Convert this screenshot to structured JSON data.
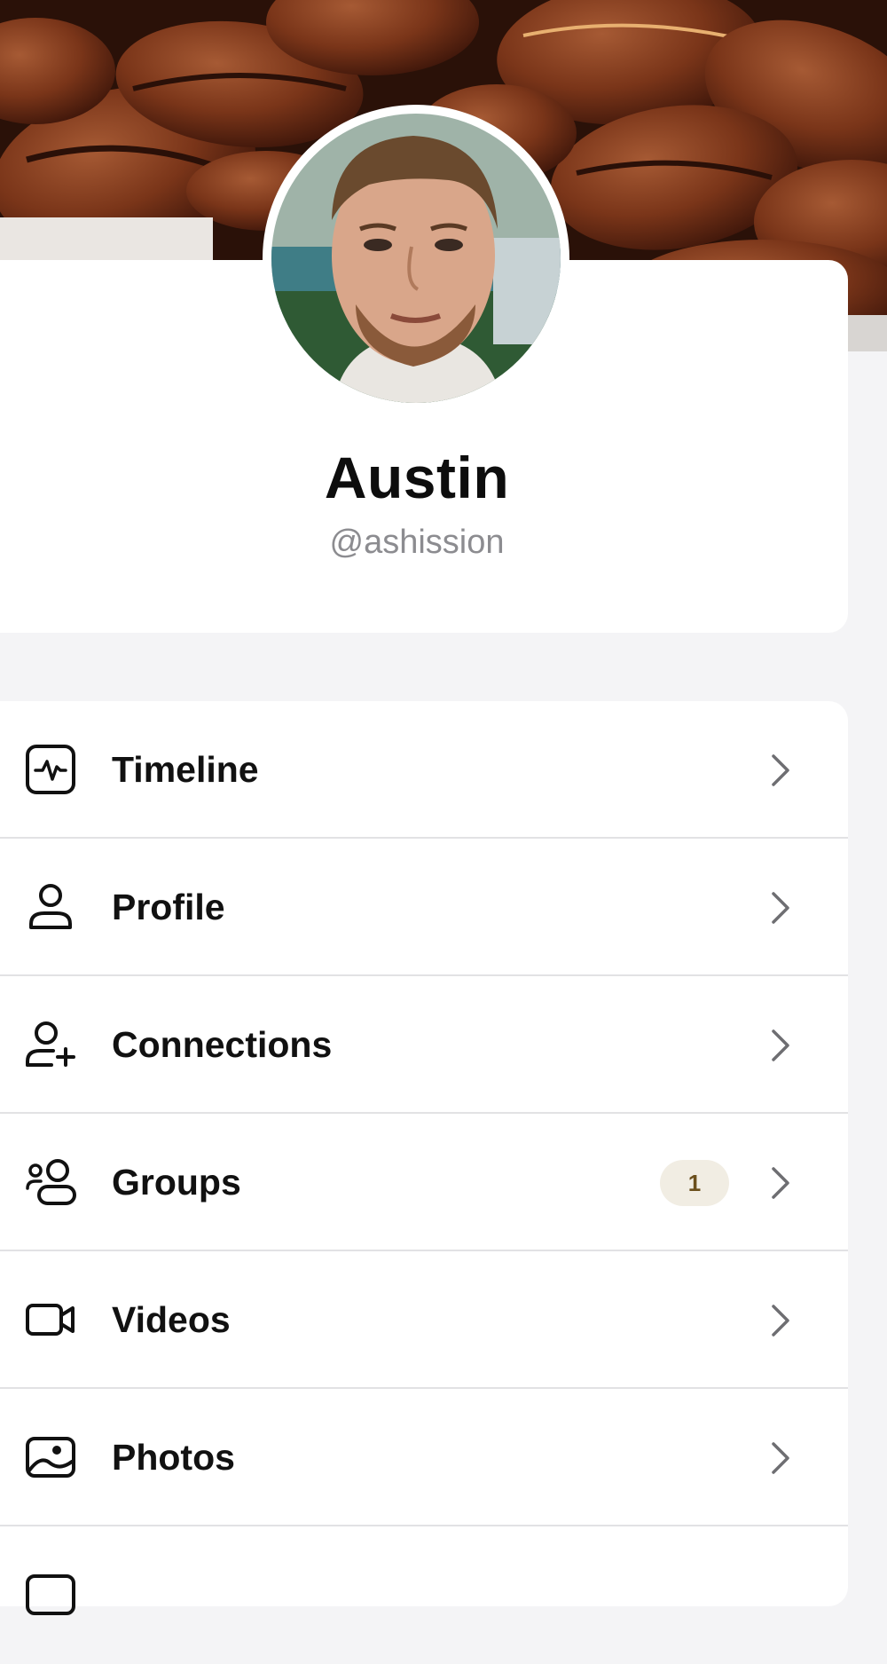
{
  "profile": {
    "name": "Austin",
    "handle": "@ashission"
  },
  "menu": {
    "items": [
      {
        "label": "Timeline",
        "icon": "activity-icon"
      },
      {
        "label": "Profile",
        "icon": "user-icon"
      },
      {
        "label": "Connections",
        "icon": "user-plus-icon"
      },
      {
        "label": "Groups",
        "icon": "users-icon",
        "badge": "1"
      },
      {
        "label": "Videos",
        "icon": "video-camera-icon"
      },
      {
        "label": "Photos",
        "icon": "image-icon"
      }
    ]
  },
  "colors": {
    "background": "#f4f4f6",
    "card": "#ffffff",
    "badge_bg": "#f1ede3",
    "badge_text": "#6b4f1c",
    "secondary_text": "#8c8c90"
  }
}
